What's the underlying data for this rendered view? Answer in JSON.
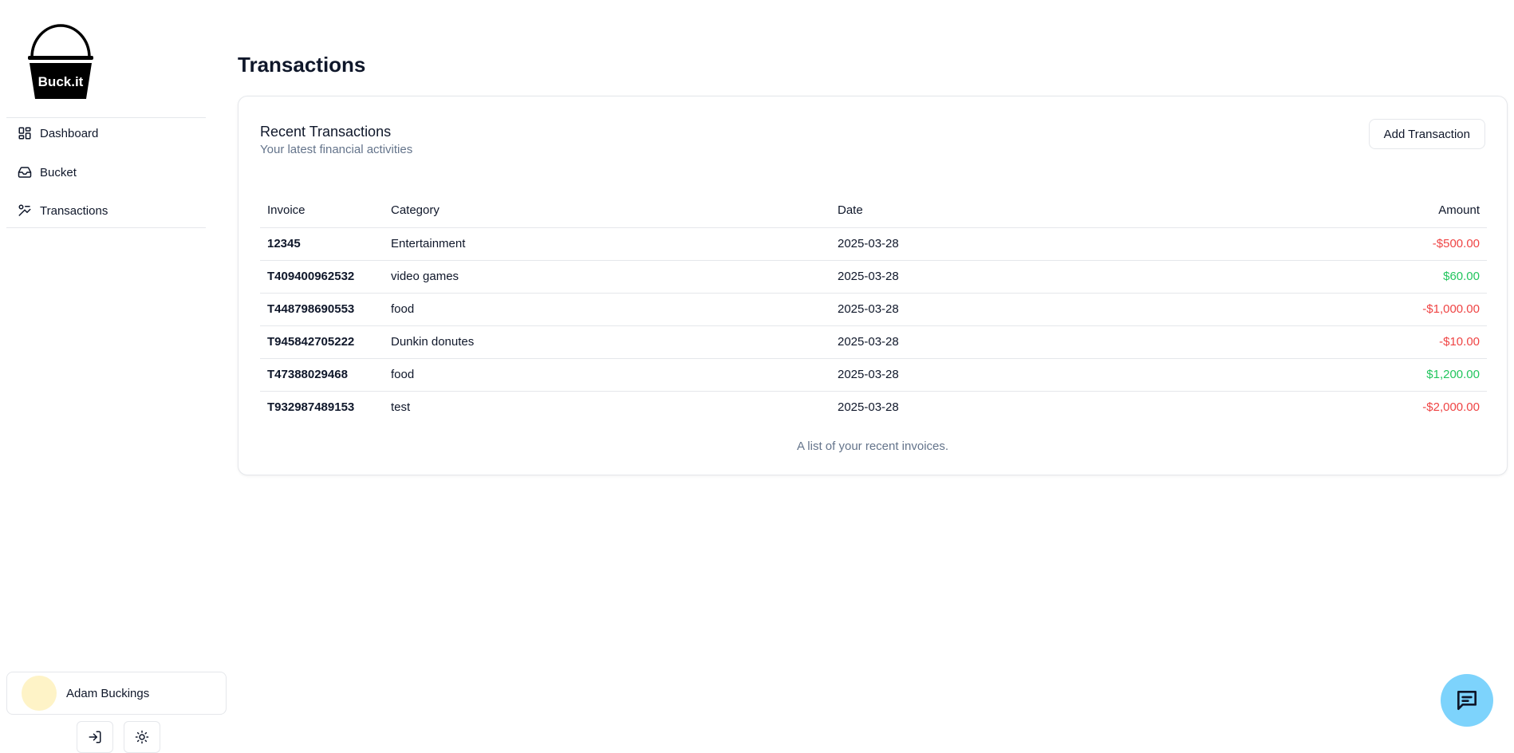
{
  "brand": {
    "logo_text": "Buck.it"
  },
  "sidebar": {
    "items": [
      {
        "label": "Dashboard",
        "icon": "dashboard-icon"
      },
      {
        "label": "Bucket",
        "icon": "inbox-icon"
      },
      {
        "label": "Transactions",
        "icon": "transactions-icon"
      }
    ],
    "user": {
      "name": "Adam Buckings",
      "avatar_color": "#fef3c7"
    },
    "footer_buttons": [
      {
        "icon": "login-icon"
      },
      {
        "icon": "sun-icon"
      }
    ]
  },
  "page": {
    "title": "Transactions"
  },
  "card": {
    "title": "Recent Transactions",
    "subtitle": "Your latest financial activities",
    "add_button": "Add Transaction",
    "columns": [
      "Invoice",
      "Category",
      "Date",
      "Amount"
    ],
    "rows": [
      {
        "invoice": "12345",
        "category": "Entertainment",
        "date": "2025-03-28",
        "amount": "-$500.00",
        "sign": "neg"
      },
      {
        "invoice": "T409400962532",
        "category": "video games",
        "date": "2025-03-28",
        "amount": "$60.00",
        "sign": "pos"
      },
      {
        "invoice": "T448798690553",
        "category": "food",
        "date": "2025-03-28",
        "amount": "-$1,000.00",
        "sign": "neg"
      },
      {
        "invoice": "T945842705222",
        "category": "Dunkin donutes",
        "date": "2025-03-28",
        "amount": "-$10.00",
        "sign": "neg"
      },
      {
        "invoice": "T47388029468",
        "category": "food",
        "date": "2025-03-28",
        "amount": "$1,200.00",
        "sign": "pos"
      },
      {
        "invoice": "T932987489153",
        "category": "test",
        "date": "2025-03-28",
        "amount": "-$2,000.00",
        "sign": "neg"
      }
    ],
    "caption": "A list of your recent invoices."
  },
  "colors": {
    "negative": "#ef4444",
    "positive": "#22c55e",
    "chat_button": "#7dd3fc"
  },
  "chat": {
    "icon": "chat-icon"
  }
}
